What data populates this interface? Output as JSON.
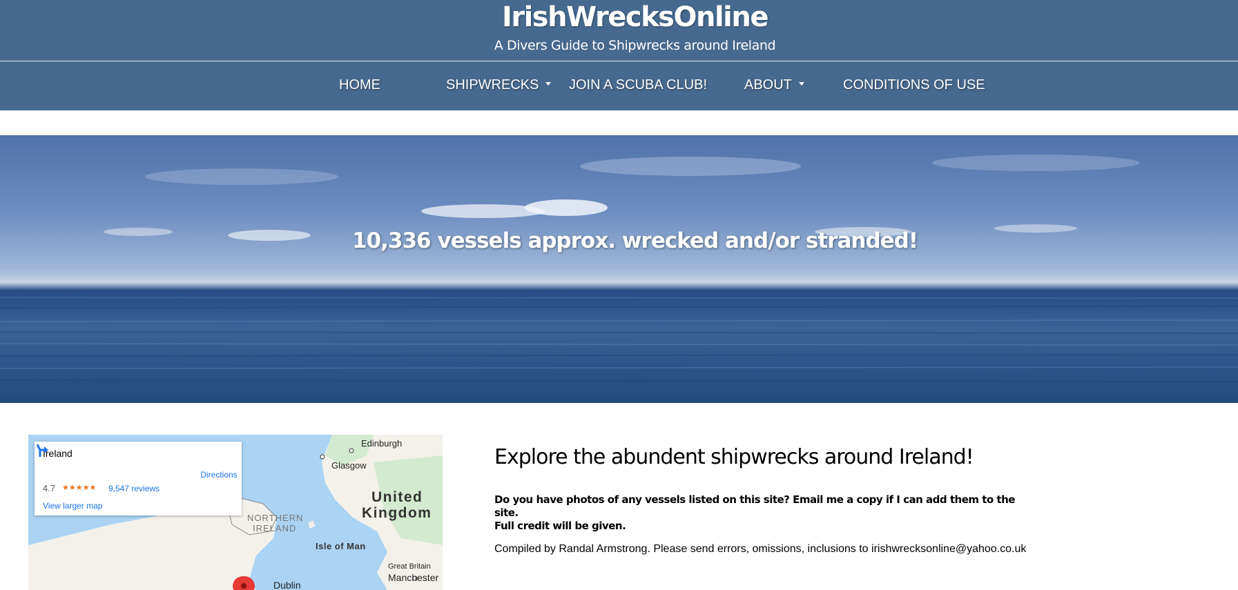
{
  "header": {
    "title": "IrishWrecksOnline",
    "tagline": "A Divers Guide to Shipwrecks around Ireland"
  },
  "nav": {
    "items": [
      {
        "label": "HOME"
      },
      {
        "label": "SHIPWRECKS"
      },
      {
        "label": "JOIN A SCUBA CLUB!"
      },
      {
        "label": "ABOUT"
      },
      {
        "label": "CONDITIONS OF USE"
      }
    ]
  },
  "hero": {
    "headline": "10,336 vessels approx. wrecked and/or stranded!"
  },
  "map": {
    "place_name": "Ireland",
    "rating": "4.7",
    "stars": "★★★★★",
    "reviews": "9,547 reviews",
    "larger_map": "View larger map",
    "directions": "Directions",
    "labels": {
      "edinburgh": "Edinburgh",
      "glasgow": "Glasgow",
      "united": "United",
      "kingdom": "Kingdom",
      "northern": "NORTHERN",
      "ireland": "IRELAND",
      "isle_of_man": "Isle of Man",
      "great_britain": "Great Britain",
      "manchester": "Manchester",
      "dublin": "Dublin"
    },
    "colors": {
      "water": "#aad3f4",
      "land": "#f3f1ea",
      "green": "#d4ead0",
      "pin": "#e53935"
    }
  },
  "content": {
    "title": "Explore the abundent shipwrecks around Ireland!",
    "para_line1": "Do you have photos of any vessels listed on this site? Email me a copy if I can add them to the site.",
    "para_line2": "Full credit will be given.",
    "credit": "Compiled by Randal Armstrong. Please send errors, omissions, inclusions to irishwrecksonline@yahoo.co.uk"
  }
}
